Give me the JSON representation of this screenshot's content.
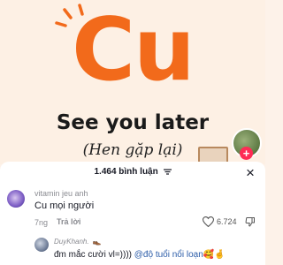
{
  "video": {
    "title": "Cu",
    "subtitle": "See you later",
    "translation": "(Hen gặp lại)",
    "accent_color": "#f26a1b"
  },
  "comments_sheet": {
    "count_label": "1.464 bình luận",
    "filter_icon": "sort-lines-icon",
    "close_icon": "close-icon",
    "close_glyph": "×"
  },
  "comments": [
    {
      "username": "vitamin jeu anh",
      "text": "Cu mọi người",
      "time": "7ng",
      "reply_label": "Trả lời",
      "like_count": "6.724"
    },
    {
      "username": "DuyKhanh.",
      "badge": "👞",
      "text_prefix": "đm mắc cười vl=)))) ",
      "mention": "@độ tuổi nổi loạn🥰🤞"
    }
  ]
}
